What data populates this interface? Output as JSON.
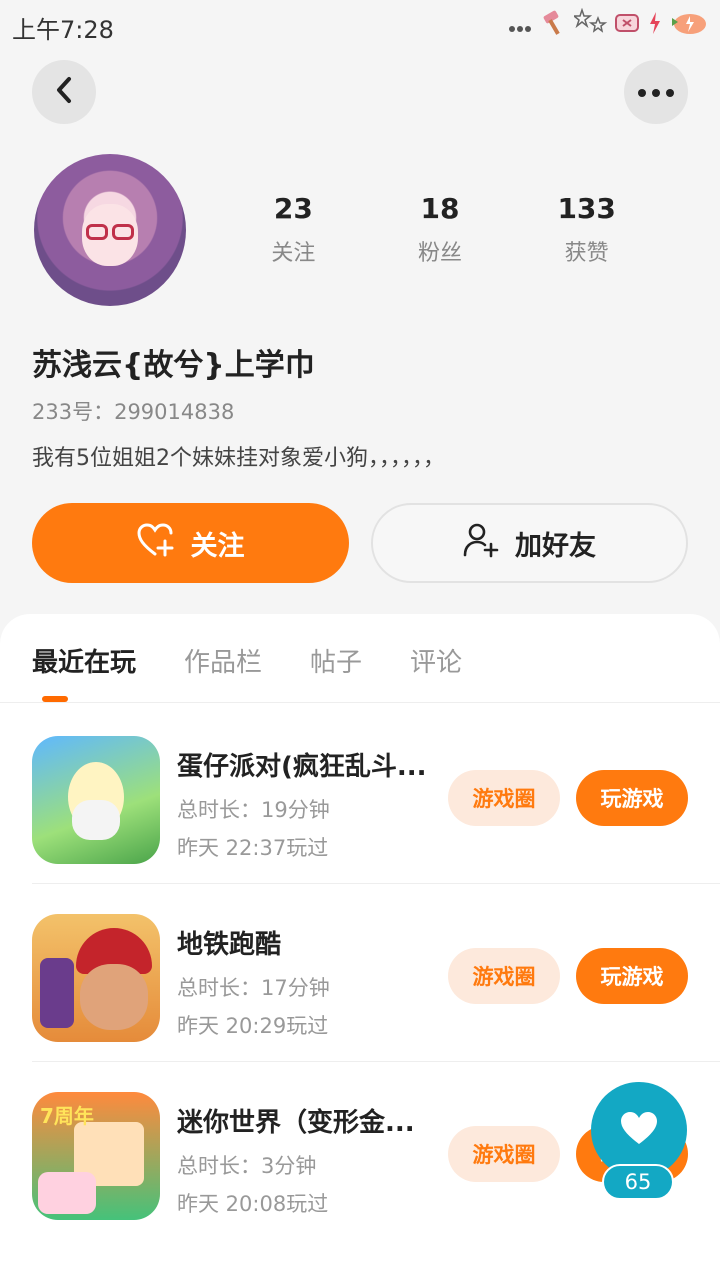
{
  "status_bar": {
    "time": "上午7:28",
    "icons": [
      "signal-dots-icon",
      "hammer-icon",
      "stars-icon",
      "flower-icon",
      "battery-icon",
      "charging-icon",
      "strawberry-icon"
    ]
  },
  "profile": {
    "stats": [
      {
        "value": "23",
        "label": "关注"
      },
      {
        "value": "18",
        "label": "粉丝"
      },
      {
        "value": "133",
        "label": "获赞"
      }
    ],
    "name": "苏浅云{故兮}上学巾",
    "id_text": "233号：299014838",
    "bio": "我有5位姐姐2个妹妹挂对象爱小狗，，，，，，"
  },
  "actions": {
    "follow_label": "关注",
    "add_friend_label": "加好友"
  },
  "tabs": [
    "最近在玩",
    "作品栏",
    "帖子",
    "评论"
  ],
  "games": [
    {
      "title": "蛋仔派对(疯狂乱斗...",
      "duration": "总时长：19分钟",
      "last_played": "昨天 22:37玩过",
      "circle_label": "游戏圈",
      "play_label": "玩游戏",
      "icon": "eggy-party-icon"
    },
    {
      "title": "地铁跑酷",
      "duration": "总时长：17分钟",
      "last_played": "昨天 20:29玩过",
      "circle_label": "游戏圈",
      "play_label": "玩游戏",
      "icon": "subway-surfers-icon"
    },
    {
      "title": "迷你世界（变形金...",
      "duration": "总时长：3分钟",
      "last_played": "昨天 20:08玩过",
      "circle_label": "游戏圈",
      "play_label": "玩游戏",
      "icon": "mini-world-icon",
      "icon_badge": "7周年"
    }
  ],
  "like_float": {
    "count": "65",
    "icon": "heart-icon"
  },
  "colors": {
    "accent": "#ff7a0f",
    "accent_light": "#fde9dc",
    "like_button": "#13a8c4"
  }
}
